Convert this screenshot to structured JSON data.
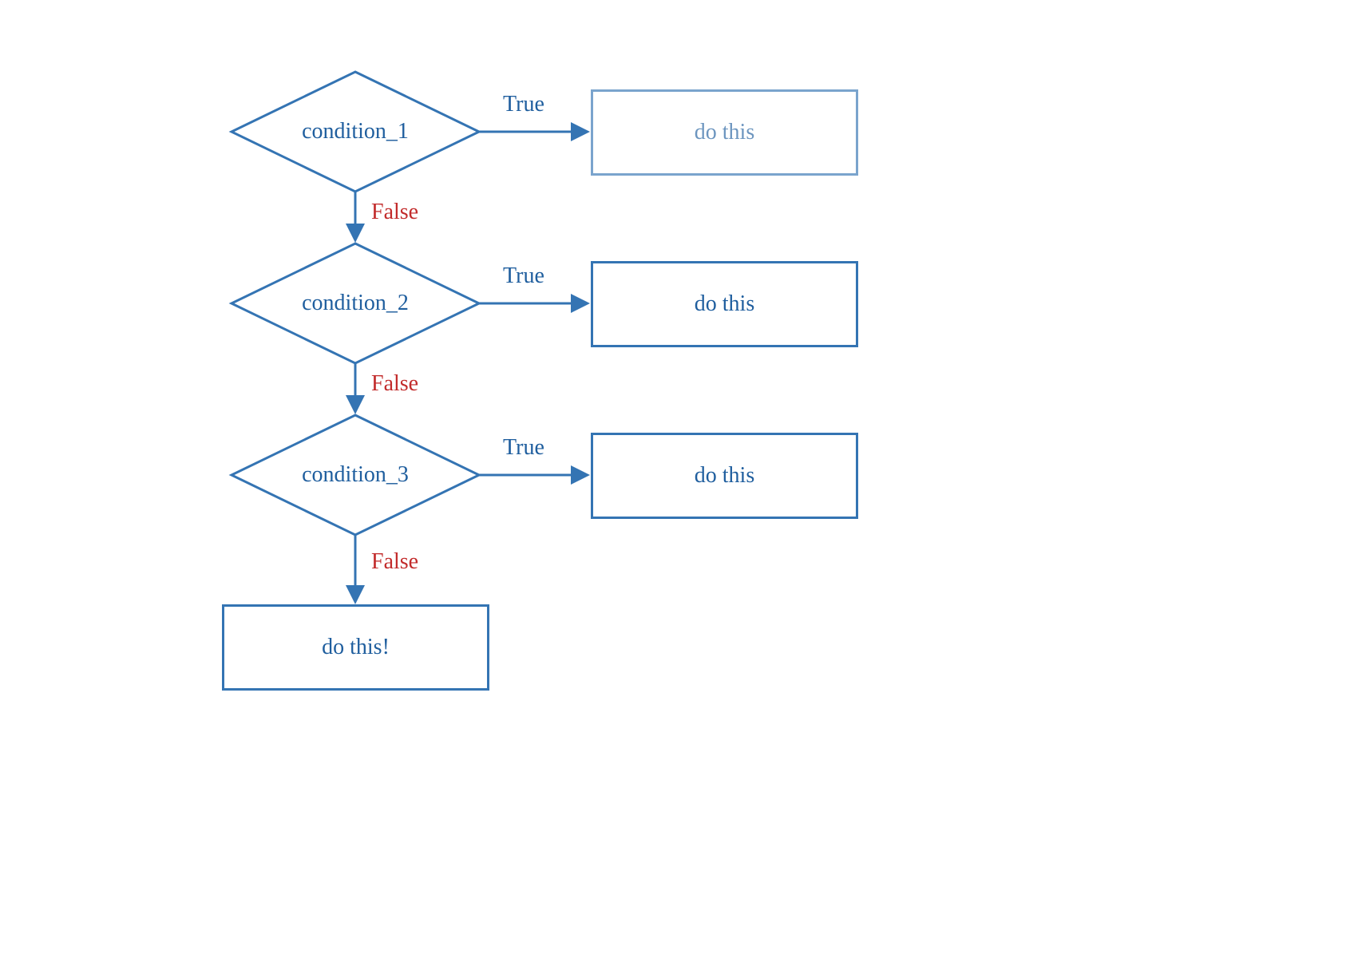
{
  "colors": {
    "stroke": "#3474b3",
    "text": "#1f5e9e",
    "trueLabel": "#1f5e9e",
    "falseLabel": "#c22b2b"
  },
  "nodes": {
    "condition1": "condition_1",
    "condition2": "condition_2",
    "condition3": "condition_3",
    "action1": "do this",
    "action2": "do this",
    "action3": "do this",
    "finalAction": "do this!"
  },
  "edges": {
    "true1": "True",
    "false1": "False",
    "true2": "True",
    "false2": "False",
    "true3": "True",
    "false3": "False"
  }
}
